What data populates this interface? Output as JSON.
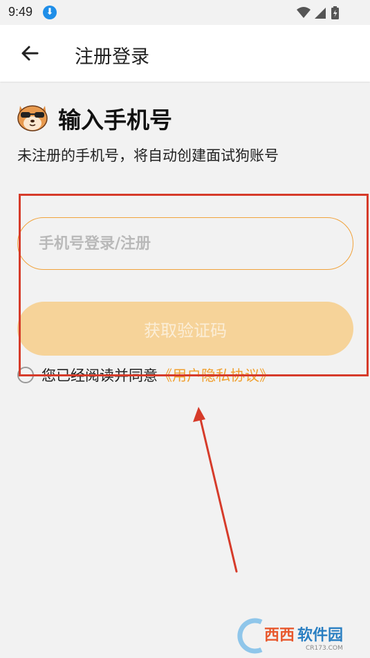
{
  "status_bar": {
    "time": "9:49",
    "icons": [
      "download-icon",
      "wifi-icon",
      "cellular-signal-icon",
      "battery-charging-icon"
    ]
  },
  "app_bar": {
    "back_icon": "arrow-left-icon",
    "title": "注册登录"
  },
  "header": {
    "avatar_icon": "shiba-sunglasses-icon",
    "heading": "输入手机号",
    "subtitle": "未注册的手机号，将自动创建面试狗账号"
  },
  "form": {
    "phone_placeholder": "手机号登录/注册",
    "phone_value": "",
    "get_code_label": "获取验证码",
    "agree_text": "您已经阅读并同意",
    "agree_link": "《用户隐私协议》",
    "agree_checked": false
  },
  "colors": {
    "accent": "#f1a23a",
    "button_disabled": "#f6d399",
    "link": "#f0a030",
    "annotation": "#d63b2a"
  },
  "watermark": {
    "logo_text": "西西软件园",
    "logo_url_text": "CR173.COM"
  }
}
